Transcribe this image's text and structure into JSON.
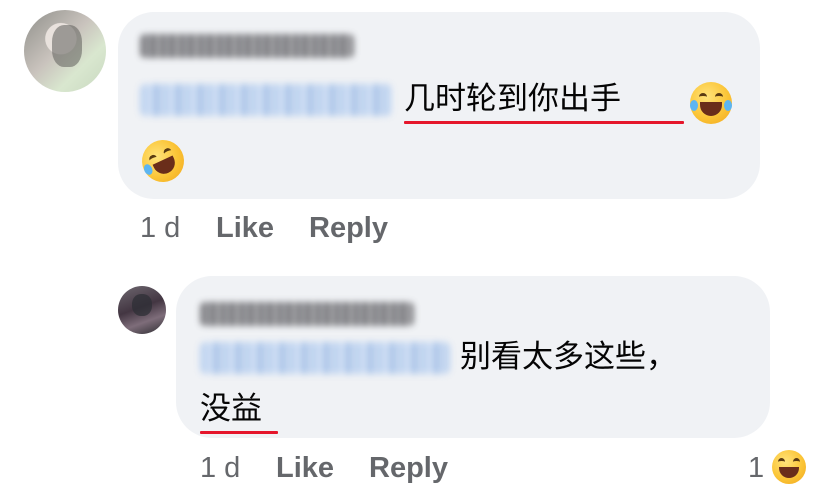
{
  "comments": [
    {
      "author": "Mun Kuby Mun",
      "mention": "Chee Wah Lee",
      "text_line1": "几时轮到你出手",
      "emoji_inline": "laughing-tears-emoji",
      "emoji_line2": "rolling-laughing-emoji",
      "time": "1 d",
      "like_label": "Like",
      "reply_label": "Reply"
    },
    {
      "author": "Chee Wah Lee",
      "mention": "Mun Kuby Mun",
      "text_line1": "别看太多这些，",
      "text_line2": "没益",
      "time": "1 d",
      "like_label": "Like",
      "reply_label": "Reply",
      "reaction_count": "1",
      "reaction_emoji": "grinning-squint-emoji"
    }
  ],
  "colors": {
    "bubble": "#f0f2f5",
    "underline": "#e5162b",
    "meta_text": "#65676b"
  }
}
